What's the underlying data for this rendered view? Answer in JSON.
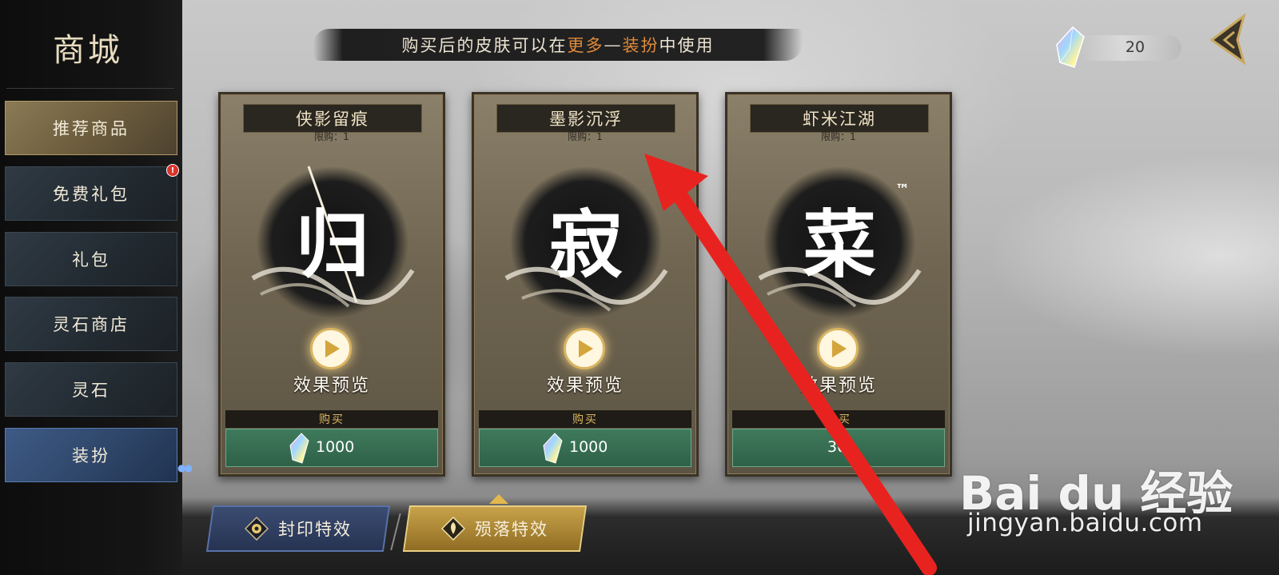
{
  "sidebar": {
    "title": "商城",
    "items": [
      {
        "label": "推荐商品",
        "state": "highlighted"
      },
      {
        "label": "免费礼包",
        "badge": "!"
      },
      {
        "label": "礼包"
      },
      {
        "label": "灵石商店"
      },
      {
        "label": "灵石"
      },
      {
        "label": "装扮",
        "state": "selected"
      }
    ]
  },
  "header": {
    "notice_prefix": "购买后的皮肤可以在",
    "notice_hl1": "更多",
    "notice_dash": "—",
    "notice_hl2": "装扮",
    "notice_suffix": "中使用"
  },
  "currency": {
    "value": "20",
    "icon": "spirit-stone-icon"
  },
  "cards": [
    {
      "name": "侠影留痕",
      "limit": "限购：1",
      "glyph": "归",
      "preview": "效果预览",
      "buy": "购买",
      "price": "1000"
    },
    {
      "name": "墨影沉浮",
      "limit": "限购：1",
      "glyph": "寂",
      "preview": "效果预览",
      "buy": "购买",
      "price": "1000"
    },
    {
      "name": "虾米江湖",
      "limit": "限购：1",
      "glyph": "菜",
      "preview": "效果预览",
      "buy": "购买",
      "price": "30"
    }
  ],
  "tabs": [
    {
      "label": "封印特效"
    },
    {
      "label": "殒落特效",
      "active": true
    }
  ],
  "watermark": {
    "logo": "Bai du 经验",
    "url": "jingyan.baidu.com"
  },
  "colors": {
    "accent_orange": "#e08a3a",
    "buy_green": "#3f7a5c",
    "gold": "#c9a24a",
    "overlay_arrow": "#e8231f"
  }
}
